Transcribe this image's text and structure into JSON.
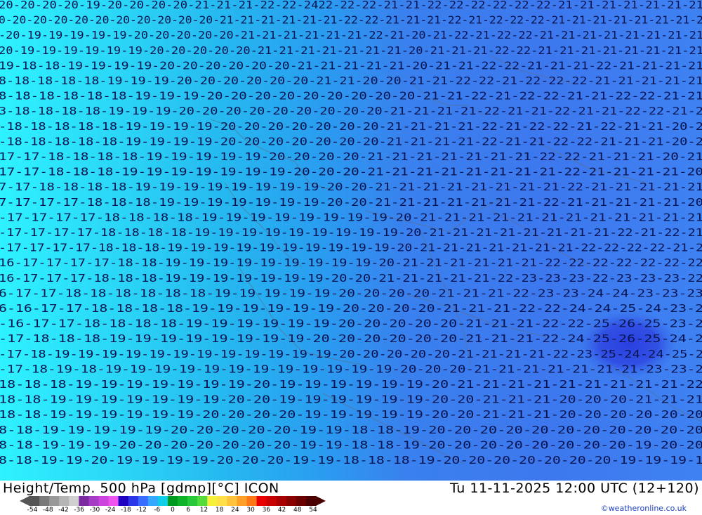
{
  "map": {
    "rows": [
      "20-20-20-20-19-20-20-20-20-21-21-21-22-22-2422-22-22-21-21-22-22-22-22-22-22-21-21-21-21-21-21-21",
      "0-20-20-20-20-20-20-20-20-20-20-21-21-21-21-21-21-22-22-21-21-21-22-21-22-22-22-21-21-21-21-21-21-21-2",
      "-20-19-19-19-19-19-20-20-20-20-20-21-21-21-21-21-21-22-21-20-21-22-21-22-22-21-21-21-21-21-21-21-21",
      "20-19-19-19-19-19-19-20-20-20-20-20-21-21-21-21-21-21-21-20-21-21-21-22-22-21-21-21-21-21-21-21-21",
      "19-18-18-19-19-19-19-20-20-20-20-20-20-21-21-21-21-21-20-21-21-22-22-21-21-21-22-21-21-21-21",
      "8-18-18-18-18-19-19-19-20-20-20-20-20-20-21-21-20-20-21-21-22-22-21-22-22-22-21-21-21-21-21",
      "8-18-18-18-18-18-19-19-19-20-20-20-20-20-20-20-20-20-21-21-22-21-22-22-21-21-22-22-21-21",
      "3-18-18-18-18-19-19-19-20-20-20-20-20-20-20-20-20-21-21-21-21-22-21-21-22-21-21-22-22-21-2",
      "-18-18-18-18-18-19-19-19-19-20-20-20-20-20-20-20-21-21-21-21-22-21-22-22-21-22-21-21-20-2",
      "-18-18-18-18-18-19-19-19-19-20-20-20-20-20-20-20-21-21-21-21-22-21-21-22-22-21-21-21-20-2",
      "17-17-18-18-18-18-19-19-19-19-19-20-20-20-20-21-21-21-21-21-21-21-22-22-21-21-21-20-21",
      "17-17-18-18-18-19-19-19-19-19-19-19-20-20-20-21-21-21-21-21-21-21-21-22-21-21-21-21-20",
      "7-17-18-18-18-18-19-19-19-19-19-19-19-19-20-20-21-21-21-21-21-21-21-21-22-21-21-21-21-21",
      "7-17-17-17-18-18-18-19-19-19-19-19-19-19-20-20-21-21-21-21-21-21-21-22-21-21-21-21-21-20",
      "-17-17-17-17-18-18-18-18-19-19-19-19-19-19-19-19-20-21-21-21-21-21-21-21-21-21-21-21-21",
      "-17-17-17-17-18-18-18-18-19-19-19-19-19-19-19-19-19-20-21-21-21-21-21-21-21-21-22-21-22-21",
      "-17-17-17-17-18-18-18-19-19-19-19-19-19-19-19-19-19-20-21-21-21-21-21-21-21-22-22-22-22-21-2",
      "16-17-17-17-17-18-18-19-19-19-19-19-19-19-19-19-20-21-21-21-21-21-21-22-22-22-22-22-22-22",
      "16-17-17-17-18-18-18-19-19-19-19-19-19-19-20-20-21-21-21-21-21-22-23-23-23-22-23-23-23-22",
      "6-17-17-18-18-18-18-18-18-19-19-19-19-19-20-20-20-20-21-21-21-22-23-23-24-24-23-23-23",
      "6-16-17-17-18-18-18-18-19-19-19-19-19-19-20-20-20-20-21-21-21-22-22-24-24-25-24-23-2",
      "-16-17-17-18-18-18-18-19-19-19-19-19-19-20-20-20-20-20-21-21-21-22-22-25-26-25-23-2",
      "-17-18-18-18-19-19-19-19-19-19-19-19-20-20-20-20-20-20-21-21-21-22-24-25-26-25-24-2",
      "-17-18-19-19-19-19-19-19-19-19-19-19-19-19-20-20-20-20-20-21-21-21-21-22-23-25-24-24-25-2",
      "-17-18-19-18-19-19-19-19-19-19-19-19-19-19-19-19-20-20-20-21-21-21-21-21-21-21-23-23-2",
      "18-18-18-19-19-19-19-19-19-19-20-19-19-19-19-19-19-20-21-21-21-21-21-21-21-21-21-22",
      "18-18-19-19-19-19-19-19-19-20-20-19-19-19-19-19-19-20-20-21-21-21-20-20-20-21-21-21",
      "18-18-19-19-19-19-19-19-20-20-20-20-19-19-19-19-19-20-20-21-21-21-20-20-20-20-20-20",
      "8-18-19-19-19-19-19-20-20-20-20-20-19-19-18-18-19-20-20-20-20-20-20-20-20-20-20-20",
      "8-18-19-19-19-20-20-20-20-20-20-20-19-19-18-18-19-20-20-20-20-20-20-20-20-19-20-20",
      "8-18-19-19-20-19-19-19-19-20-20-20-19-19-18-18-18-19-20-20-20-20-20-20-20-19-19-19-1"
    ]
  },
  "footer": {
    "title_left": "Height/Temp. 500 hPa [gdmp][°C] ICON",
    "title_right": "Tu 11-11-2025 12:00 UTC (12+120)",
    "credit": "©weatheronline.co.uk"
  },
  "colorbar": {
    "ticks": [
      "-54",
      "-48",
      "-42",
      "-36",
      "-30",
      "-24",
      "-18",
      "-12",
      "-6",
      "0",
      "6",
      "12",
      "18",
      "24",
      "30",
      "36",
      "42",
      "48",
      "54"
    ],
    "colors": [
      "#555555",
      "#7a7a7a",
      "#999999",
      "#b5b5b5",
      "#d0d0d0",
      "#7c2aa0",
      "#a43cc4",
      "#cc44dd",
      "#ee55ee",
      "#2000c0",
      "#2a36e8",
      "#3a6cff",
      "#35a8ff",
      "#10cfe8",
      "#009a20",
      "#10b22c",
      "#28c83a",
      "#55dc3c",
      "#f4f03c",
      "#ffe048",
      "#ffc43c",
      "#ffa028",
      "#ff7818",
      "#e80000",
      "#c80000",
      "#a80000",
      "#880000",
      "#6a0000",
      "#4a0000"
    ]
  }
}
